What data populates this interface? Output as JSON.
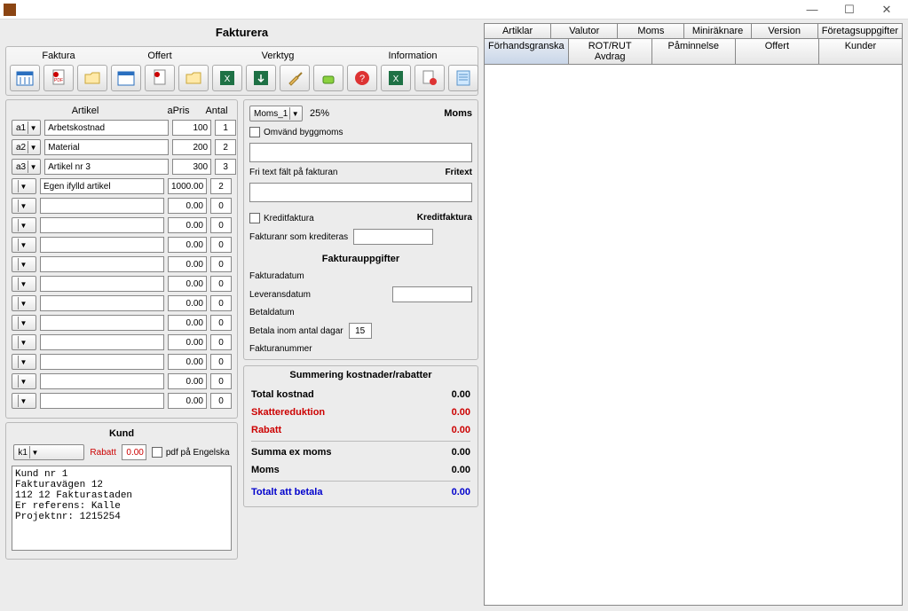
{
  "window": {
    "minimize": "—",
    "maximize": "☐",
    "close": "✕"
  },
  "title": "Fakturera",
  "toolbar": {
    "groups": {
      "faktura": "Faktura",
      "offert": "Offert",
      "verktyg": "Verktyg",
      "information": "Information"
    }
  },
  "grid": {
    "headers": {
      "artikel": "Artikel",
      "apris": "aPris",
      "antal": "Antal"
    },
    "rows": [
      {
        "code": "a1",
        "name": "Arbetskostnad",
        "pris": "100",
        "antal": "1"
      },
      {
        "code": "a2",
        "name": "Material",
        "pris": "200",
        "antal": "2"
      },
      {
        "code": "a3",
        "name": "Artikel nr 3",
        "pris": "300",
        "antal": "3"
      },
      {
        "code": "",
        "name": "Egen ifylld artikel",
        "pris": "1000.00",
        "antal": "2"
      },
      {
        "code": "",
        "name": "",
        "pris": "0.00",
        "antal": "0"
      },
      {
        "code": "",
        "name": "",
        "pris": "0.00",
        "antal": "0"
      },
      {
        "code": "",
        "name": "",
        "pris": "0.00",
        "antal": "0"
      },
      {
        "code": "",
        "name": "",
        "pris": "0.00",
        "antal": "0"
      },
      {
        "code": "",
        "name": "",
        "pris": "0.00",
        "antal": "0"
      },
      {
        "code": "",
        "name": "",
        "pris": "0.00",
        "antal": "0"
      },
      {
        "code": "",
        "name": "",
        "pris": "0.00",
        "antal": "0"
      },
      {
        "code": "",
        "name": "",
        "pris": "0.00",
        "antal": "0"
      },
      {
        "code": "",
        "name": "",
        "pris": "0.00",
        "antal": "0"
      },
      {
        "code": "",
        "name": "",
        "pris": "0.00",
        "antal": "0"
      },
      {
        "code": "",
        "name": "",
        "pris": "0.00",
        "antal": "0"
      }
    ]
  },
  "kund": {
    "title": "Kund",
    "combo": "k1",
    "rabatt_label": "Rabatt",
    "rabatt_value": "0.00",
    "pdf_eng": "pdf på Engelska",
    "text": "Kund nr 1\nFakturavägen 12\n112 12 Fakturastaden\nEr referens: Kalle\nProjektnr: 1215254"
  },
  "moms": {
    "combo": "Moms_1",
    "pct": "25%",
    "heading": "Moms",
    "omvand": "Omvänd byggmoms",
    "fritext_lbl": "Fri text fält på fakturan",
    "fritext_head": "Fritext",
    "kredit_chk": "Kreditfaktura",
    "kredit_head": "Kreditfaktura",
    "krediteras_lbl": "Fakturanr som krediteras",
    "faktura_uppgifter": "Fakturauppgifter",
    "fakturadatum": "Fakturadatum",
    "leveransdatum": "Leveransdatum",
    "betaldatum": "Betaldatum",
    "betala_dagar_lbl": "Betala inom antal dagar",
    "betala_dagar_val": "15",
    "fakturanummer": "Fakturanummer"
  },
  "summary": {
    "title": "Summering kostnader/rabatter",
    "total_kostnad": {
      "label": "Total kostnad",
      "value": "0.00"
    },
    "skattereduktion": {
      "label": "Skattereduktion",
      "value": "0.00"
    },
    "rabatt": {
      "label": "Rabatt",
      "value": "0.00"
    },
    "summa_ex_moms": {
      "label": "Summa ex moms",
      "value": "0.00"
    },
    "moms": {
      "label": "Moms",
      "value": "0.00"
    },
    "totalt": {
      "label": "Totalt att betala",
      "value": "0.00"
    }
  },
  "tabs": {
    "row1": [
      "Artiklar",
      "Valutor",
      "Moms",
      "Miniräknare",
      "Version",
      "Företagsuppgifter"
    ],
    "row2": [
      "Förhandsgranska",
      "ROT/RUT Avdrag",
      "Påminnelse",
      "Offert",
      "Kunder"
    ],
    "active": "Förhandsgranska"
  }
}
